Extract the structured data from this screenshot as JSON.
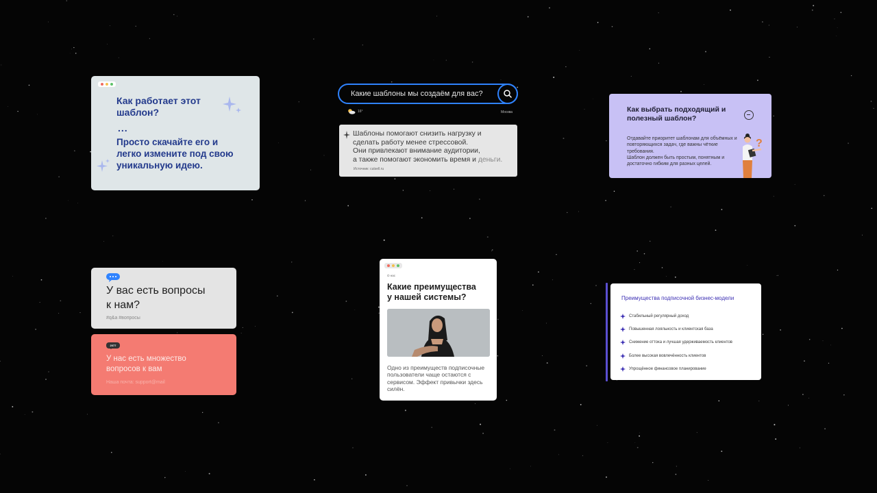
{
  "card_template": {
    "question": "Как работает этот шаблон?",
    "ellipsis": "...",
    "answer": "Просто скачайте его и легко измените под свою уникальную идею."
  },
  "search": {
    "query": "Какие шаблоны мы создаём для вас?",
    "weather": "16°",
    "city": "Москва",
    "result_lines": [
      "Шаблоны помогают снизить нагрузку и",
      "сделать работу менее стрессовой.",
      "Они привлекают внимание аудитории,",
      "а также помогают экономить время и"
    ],
    "result_muted": "деньги.",
    "source": "Источник: cutsell.ru"
  },
  "choose_card": {
    "title": "Как выбрать подходящий и полезный шаблон?",
    "body_1": "Отдавайте приоритет шаблонам для объёмных и повторяющихся задач, где важны чёткие требования.",
    "body_2": "Шаблон должен быть простым, понятным и достаточно гибким для разных целей."
  },
  "questions_card": {
    "title": "У вас есть вопросы к нам?",
    "tags": "#q&a #вопросы"
  },
  "many_questions_card": {
    "badge": "2077",
    "title": "У нас есть множество вопросов к вам",
    "footer": "Наша почта: support@mail"
  },
  "advantages_card": {
    "label": "О нас",
    "title": "Какие преимущества у нашей системы?",
    "text": "Одно из преимуществ подписочные пользователи чаще остаются с сервисом. Эффект привычки здесь силён."
  },
  "business_card": {
    "title": "Преимущества подписочной бизнес-модели",
    "items": [
      "Стабильный регулярный доход",
      "Повышенная лояльность и клиентская база",
      "Снижение оттока и лучшая удерживаемость клиентов",
      "Более высокая вовлечённость клиентов",
      "Упрощённое финансовое планирование"
    ]
  },
  "colors": {
    "background": "#050505",
    "accent_blue": "#2f83ff",
    "navy_text": "#233a8c",
    "purple_card": "#c8c1f5",
    "coral_card": "#f47b72",
    "business_accent": "#5b4fd1"
  }
}
